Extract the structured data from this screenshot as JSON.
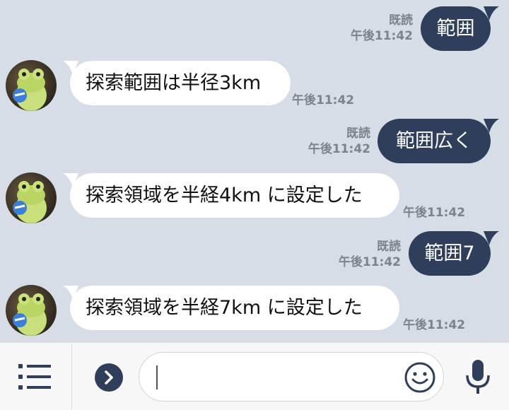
{
  "messages": [
    {
      "dir": "out",
      "text": "範囲",
      "read": "既読",
      "time": "午後11:42"
    },
    {
      "dir": "in",
      "text": "探索範囲は半径3km",
      "time": "午後11:42"
    },
    {
      "dir": "out",
      "text": "範囲広く",
      "read": "既読",
      "time": "午後11:42"
    },
    {
      "dir": "in",
      "text": "探索領域を半経4km に設定した",
      "time": "午後11:42"
    },
    {
      "dir": "out",
      "text": "範囲7",
      "read": "既読",
      "time": "午後11:42"
    },
    {
      "dir": "in",
      "text": "探索領域を半経7km に設定した",
      "time": "午後11:42"
    }
  ],
  "input": {
    "value": "",
    "placeholder": ""
  },
  "icons": {
    "menu": "menu-icon",
    "expand": "chevron-right-icon",
    "emoji": "emoji-icon",
    "mic": "microphone-icon"
  },
  "colors": {
    "background": "#d6dde6",
    "outgoing_bubble": "#2f3f5b",
    "incoming_bubble": "#ffffff",
    "meta_text": "#7d838b"
  }
}
